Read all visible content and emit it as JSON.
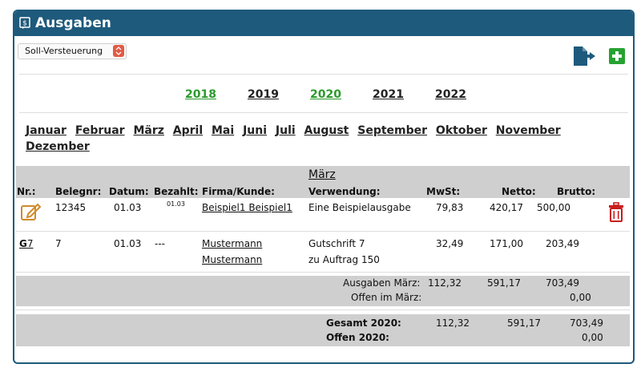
{
  "header": {
    "title": "Ausgaben"
  },
  "mode_select": {
    "value": "Soll-Versteuerung"
  },
  "years": [
    {
      "label": "2018",
      "highlight": true
    },
    {
      "label": "2019",
      "highlight": false
    },
    {
      "label": "2020",
      "highlight": true
    },
    {
      "label": "2021",
      "highlight": false
    },
    {
      "label": "2022",
      "highlight": false
    }
  ],
  "months": [
    "Januar",
    "Februar",
    "März",
    "April",
    "Mai",
    "Juni",
    "Juli",
    "August",
    "September",
    "Oktober",
    "November",
    "Dezember"
  ],
  "table": {
    "month_title": "März",
    "headers": {
      "nr": "Nr.:",
      "belegnr": "Belegnr:",
      "datum": "Datum:",
      "bezahlt": "Bezahlt:",
      "firma": "Firma/Kunde:",
      "verwendung": "Verwendung:",
      "mwst": "MwSt:",
      "netto": "Netto:",
      "brutto": "Brutto:"
    },
    "rows": [
      {
        "nr": "",
        "belegnr": "12345",
        "datum": "01.03",
        "bezahlt": "01.03",
        "firma": "Beispiel1 Beispiel1",
        "verwendung": "Eine Beispielausgabe",
        "mwst": "79,83",
        "netto": "420,17",
        "brutto": "500,00"
      },
      {
        "nr_prefix": "G",
        "nr": "7",
        "belegnr": "7",
        "datum": "01.03",
        "bezahlt": "---",
        "firma_line1": "Mustermann",
        "firma_line2": "Mustermann",
        "verwendung_line1": "Gutschrift 7",
        "verwendung_line2": "zu Auftrag 150",
        "mwst": "32,49",
        "netto": "171,00",
        "brutto": "203,49"
      }
    ],
    "month_summary": {
      "ausgaben_label": "Ausgaben März:",
      "ausgaben_mwst": "112,32",
      "ausgaben_netto": "591,17",
      "ausgaben_brutto": "703,49",
      "offen_label": "Offen im März:",
      "offen_brutto": "0,00"
    },
    "year_summary": {
      "gesamt_label": "Gesamt 2020:",
      "gesamt_mwst": "112,32",
      "gesamt_netto": "591,17",
      "gesamt_brutto": "703,49",
      "offen_label": "Offen 2020:",
      "offen_brutto": "0,00"
    }
  },
  "colors": {
    "header_bg": "#1e5a7c",
    "year_highlight": "#2a9a2a",
    "add": "#26a232",
    "edit": "#d08a2a",
    "delete": "#c81e1e"
  }
}
